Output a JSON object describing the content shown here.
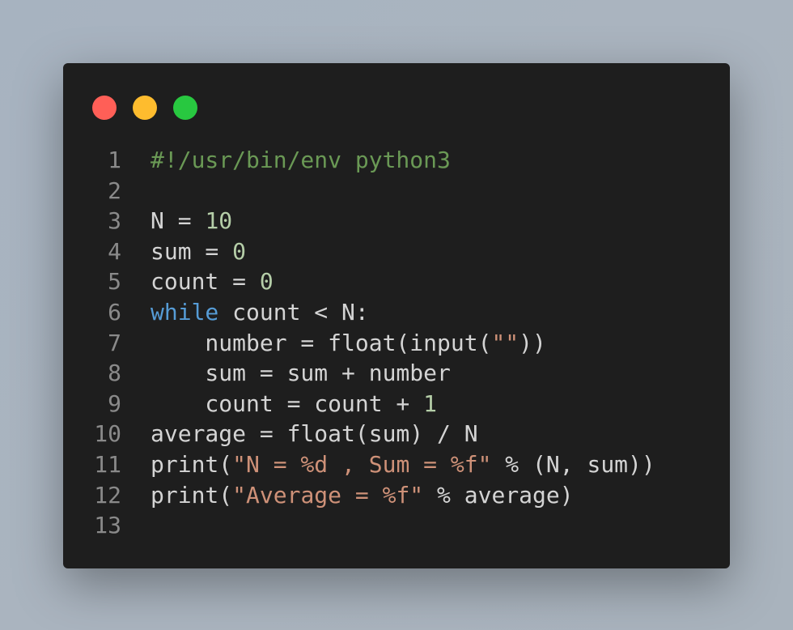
{
  "window": {
    "controls": [
      {
        "name": "close",
        "color": "#ff5f57"
      },
      {
        "name": "minimize",
        "color": "#febc2e"
      },
      {
        "name": "maximize",
        "color": "#28c840"
      }
    ]
  },
  "colors": {
    "background": "#1e1e1e",
    "comment": "#6a9955",
    "number": "#b5cea8",
    "keyword": "#569cd6",
    "string": "#ce9178",
    "text": "#d4d4d4",
    "line_number": "#8a8a8a"
  },
  "code_lines": [
    {
      "n": "1",
      "tokens": [
        {
          "t": "#!/usr/bin/env python3",
          "k": "comment"
        }
      ]
    },
    {
      "n": "2",
      "tokens": []
    },
    {
      "n": "3",
      "tokens": [
        {
          "t": "N = ",
          "k": "plain"
        },
        {
          "t": "10",
          "k": "num"
        }
      ]
    },
    {
      "n": "4",
      "tokens": [
        {
          "t": "sum = ",
          "k": "plain"
        },
        {
          "t": "0",
          "k": "num"
        }
      ]
    },
    {
      "n": "5",
      "tokens": [
        {
          "t": "count = ",
          "k": "plain"
        },
        {
          "t": "0",
          "k": "num"
        }
      ]
    },
    {
      "n": "6",
      "tokens": [
        {
          "t": "while",
          "k": "kw"
        },
        {
          "t": " count < N:",
          "k": "plain"
        }
      ]
    },
    {
      "n": "7",
      "tokens": [
        {
          "t": "    number = float(input(",
          "k": "plain"
        },
        {
          "t": "\"\"",
          "k": "str"
        },
        {
          "t": "))",
          "k": "plain"
        }
      ]
    },
    {
      "n": "8",
      "tokens": [
        {
          "t": "    sum = sum + number",
          "k": "plain"
        }
      ]
    },
    {
      "n": "9",
      "tokens": [
        {
          "t": "    count = count + ",
          "k": "plain"
        },
        {
          "t": "1",
          "k": "num"
        }
      ]
    },
    {
      "n": "10",
      "tokens": [
        {
          "t": "average = float(sum) / N",
          "k": "plain"
        }
      ]
    },
    {
      "n": "11",
      "tokens": [
        {
          "t": "print(",
          "k": "plain"
        },
        {
          "t": "\"N = %d , Sum = %f\"",
          "k": "str"
        },
        {
          "t": " % (N, sum))",
          "k": "plain"
        }
      ]
    },
    {
      "n": "12",
      "tokens": [
        {
          "t": "print(",
          "k": "plain"
        },
        {
          "t": "\"Average = %f\"",
          "k": "str"
        },
        {
          "t": " % average)",
          "k": "plain"
        }
      ]
    },
    {
      "n": "13",
      "tokens": []
    }
  ]
}
